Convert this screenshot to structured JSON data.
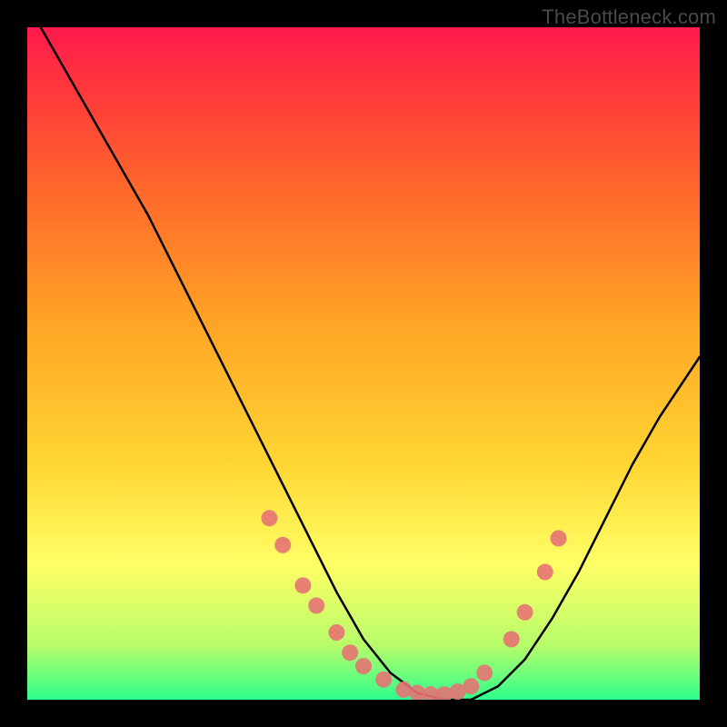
{
  "watermark": "TheBottleneck.com",
  "chart_data": {
    "type": "line",
    "title": "",
    "xlabel": "",
    "ylabel": "",
    "xlim": [
      0,
      100
    ],
    "ylim": [
      0,
      100
    ],
    "series": [
      {
        "name": "curve",
        "x": [
          2,
          6,
          10,
          14,
          18,
          22,
          26,
          30,
          34,
          38,
          42,
          46,
          50,
          54,
          58,
          62,
          66,
          70,
          74,
          78,
          82,
          86,
          90,
          94,
          98,
          100
        ],
        "y": [
          100,
          93,
          86,
          79,
          72,
          64,
          56,
          48,
          40,
          32,
          24,
          16,
          9,
          4,
          1,
          0,
          0,
          2,
          6,
          12,
          19,
          27,
          35,
          42,
          48,
          51
        ]
      }
    ],
    "markers": [
      {
        "x": 36,
        "y": 27
      },
      {
        "x": 38,
        "y": 23
      },
      {
        "x": 41,
        "y": 17
      },
      {
        "x": 43,
        "y": 14
      },
      {
        "x": 46,
        "y": 10
      },
      {
        "x": 48,
        "y": 7
      },
      {
        "x": 50,
        "y": 5
      },
      {
        "x": 53,
        "y": 3
      },
      {
        "x": 56,
        "y": 1.5
      },
      {
        "x": 58,
        "y": 1
      },
      {
        "x": 60,
        "y": 0.8
      },
      {
        "x": 62,
        "y": 0.8
      },
      {
        "x": 64,
        "y": 1.2
      },
      {
        "x": 66,
        "y": 2
      },
      {
        "x": 68,
        "y": 4
      },
      {
        "x": 72,
        "y": 9
      },
      {
        "x": 74,
        "y": 13
      },
      {
        "x": 77,
        "y": 19
      },
      {
        "x": 79,
        "y": 24
      }
    ],
    "background_gradient": [
      "#ff1a4d",
      "#ff3a3a",
      "#ff6a2a",
      "#ffa726",
      "#ffd633",
      "#ffff66",
      "#b6fc6a",
      "#2eff8c"
    ]
  }
}
